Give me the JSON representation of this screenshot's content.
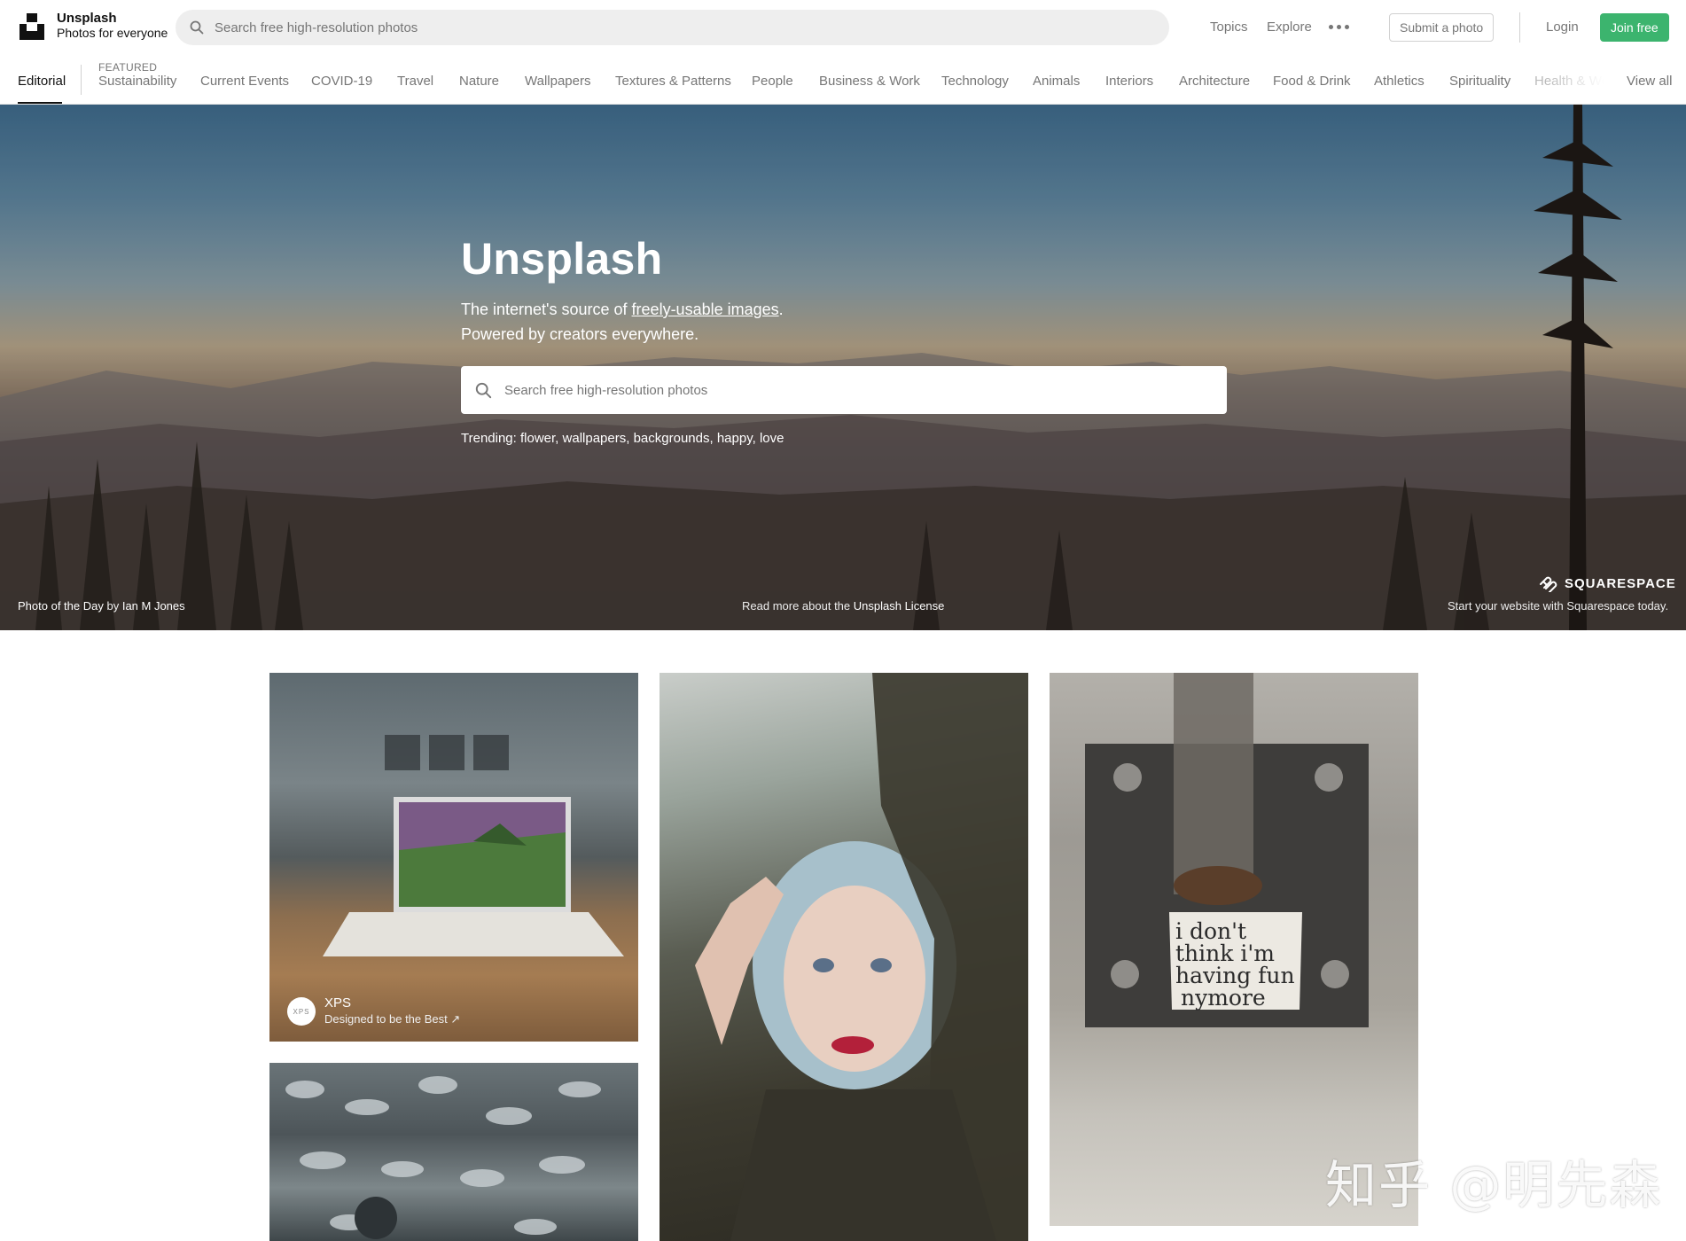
{
  "header": {
    "logo_name": "Unsplash",
    "logo_tagline": "Photos for everyone",
    "search_placeholder": "Search free high-resolution photos",
    "nav_topics": "Topics",
    "nav_explore": "Explore",
    "submit_label": "Submit a photo",
    "login_label": "Login",
    "join_label": "Join free"
  },
  "topics": {
    "active": "Editorial",
    "featured_label": "FEATURED",
    "featured_item": "Sustainability",
    "items": [
      "Current Events",
      "COVID-19",
      "Travel",
      "Nature",
      "Wallpapers",
      "Textures & Patterns",
      "People",
      "Business & Work",
      "Technology",
      "Animals",
      "Interiors",
      "Architecture",
      "Food & Drink",
      "Athletics",
      "Spirituality"
    ],
    "faded_item": "Health & Wellness",
    "view_all": "View all"
  },
  "hero": {
    "title": "Unsplash",
    "subtitle_prefix": "The internet's source of ",
    "subtitle_link": "freely-usable images",
    "subtitle_suffix": ".",
    "subtitle_line2": "Powered by creators everywhere.",
    "search_placeholder": "Search free high-resolution photos",
    "trending_label": "Trending:",
    "trending": [
      "flower",
      "wallpapers",
      "backgrounds",
      "happy",
      "love"
    ],
    "photo_of_day_label": "Photo of the Day",
    "photo_by": "by",
    "photographer": "Ian M Jones",
    "license_prefix": "Read more about the",
    "license_link": "Unsplash License",
    "sponsor_name": "SQUARESPACE",
    "sponsor_tagline": "Start your website with Squarespace today."
  },
  "photos": {
    "sponsored_avatar": "XPS",
    "sponsored_name": "XPS",
    "sponsored_desc": "Designed to be the Best ↗",
    "sign_text": [
      "i don't",
      "think i'm",
      "having fun",
      "nymore"
    ]
  },
  "watermark": "知乎 @明先森",
  "colors": {
    "accent_green": "#3cb46e",
    "muted_text": "#767676",
    "search_bg": "#eeeeee"
  }
}
